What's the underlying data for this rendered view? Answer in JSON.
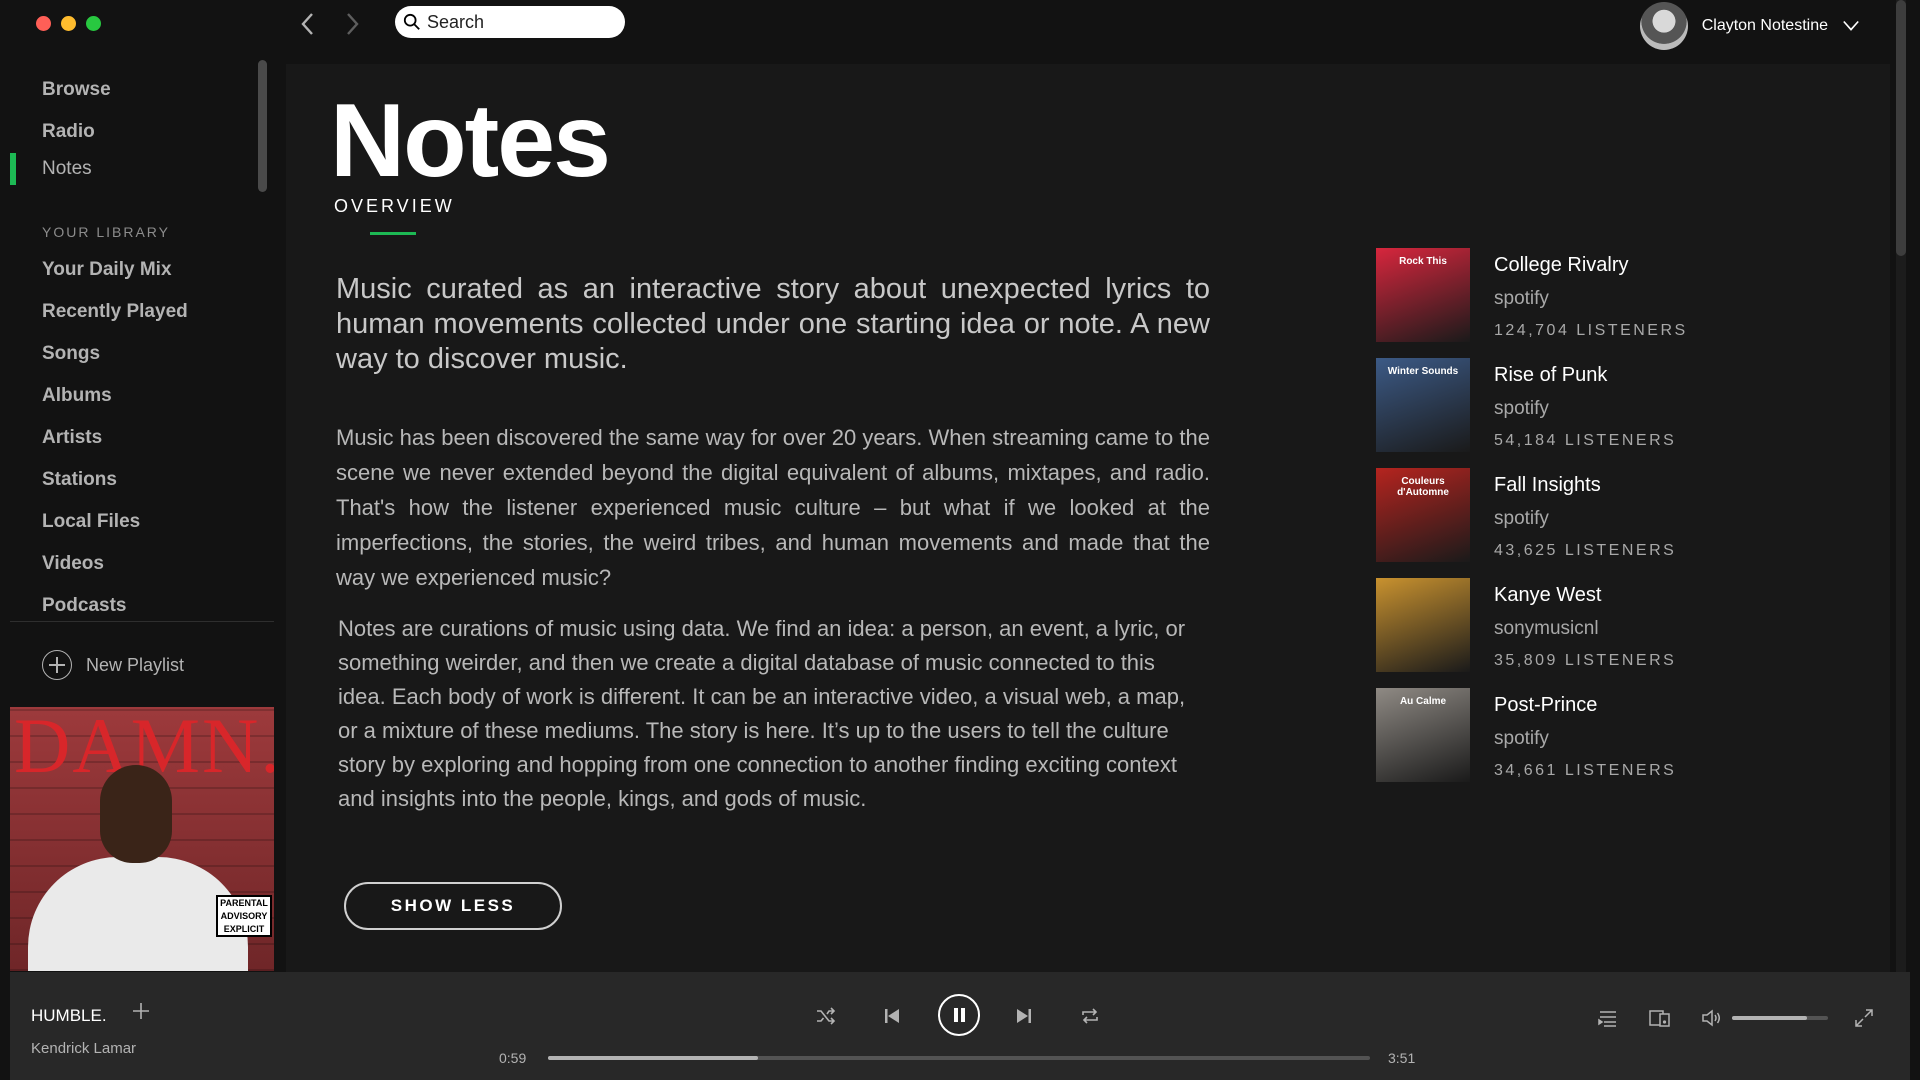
{
  "window": {
    "traffic_colors": [
      "#ff5f57",
      "#febc2e",
      "#28c840"
    ]
  },
  "topbar": {
    "search_placeholder": "Search",
    "user_name": "Clayton Notestine"
  },
  "sidebar": {
    "nav": [
      {
        "label": "Browse"
      },
      {
        "label": "Radio"
      },
      {
        "label": "Notes",
        "active": true
      }
    ],
    "library_title": "YOUR LIBRARY",
    "library": [
      {
        "label": "Your Daily Mix"
      },
      {
        "label": "Recently Played"
      },
      {
        "label": "Songs"
      },
      {
        "label": "Albums"
      },
      {
        "label": "Artists"
      },
      {
        "label": "Stations"
      },
      {
        "label": "Local Files"
      },
      {
        "label": "Videos"
      },
      {
        "label": "Podcasts"
      }
    ],
    "new_playlist": "New Playlist",
    "album_art": {
      "title_text": "DAMN.",
      "advisory": "PARENTAL ADVISORY EXPLICIT CONTENT"
    }
  },
  "main": {
    "title": "Notes",
    "tab": "OVERVIEW",
    "lead": "Music curated as an interactive story about unexpected lyrics to human movements collected under one starting idea or note. A new way to discover music.",
    "para1": "Music has been discovered the same way for over 20 years. When streaming came to the scene we never extended beyond the digital equivalent of albums, mixtapes, and radio. That's how the listener experienced music culture – but what if we looked at the imperfections, the stories, the weird tribes, and human movements and made that the way we experienced music?",
    "para2": "Notes are curations of music using data. We find an idea: a person, an event, a lyric, or something weirder, and then we create a digital database of music connected to this idea. Each body of work is different. It can be an interactive video, a visual web, a map, or a mixture of these mediums. The story is here. It’s up to the users to tell the culture story by exploring and hopping from one connection to another finding exciting context and insights into the people, kings, and gods of music.",
    "show_less": "SHOW LESS"
  },
  "related": [
    {
      "name": "College Rivalry",
      "owner": "spotify",
      "listeners": "124,704 LISTENERS",
      "thumb_text": "Rock This",
      "thumb_color": "#d7263d"
    },
    {
      "name": "Rise of Punk",
      "owner": "spotify",
      "listeners": "54,184 LISTENERS",
      "thumb_text": "Winter Sounds",
      "thumb_color": "#3c5a86"
    },
    {
      "name": "Fall Insights",
      "owner": "spotify",
      "listeners": "43,625 LISTENERS",
      "thumb_text": "Couleurs d'Automne",
      "thumb_color": "#b5241f"
    },
    {
      "name": "Kanye West",
      "owner": "sonymusicnl",
      "listeners": "35,809 LISTENERS",
      "thumb_text": "",
      "thumb_color": "#c9922f"
    },
    {
      "name": "Post-Prince",
      "owner": "spotify",
      "listeners": "34,661 LISTENERS",
      "thumb_text": "Au Calme",
      "thumb_color": "#8f8a84"
    }
  ],
  "player": {
    "track": "HUMBLE.",
    "artist": "Kendrick Lamar",
    "elapsed": "0:59",
    "total": "3:51",
    "progress": 0.255,
    "volume": 0.78,
    "icons": [
      "shuffle-icon",
      "previous-icon",
      "pause-icon",
      "next-icon",
      "repeat-icon",
      "queue-icon",
      "devices-icon",
      "volume-icon",
      "fullscreen-icon"
    ]
  }
}
